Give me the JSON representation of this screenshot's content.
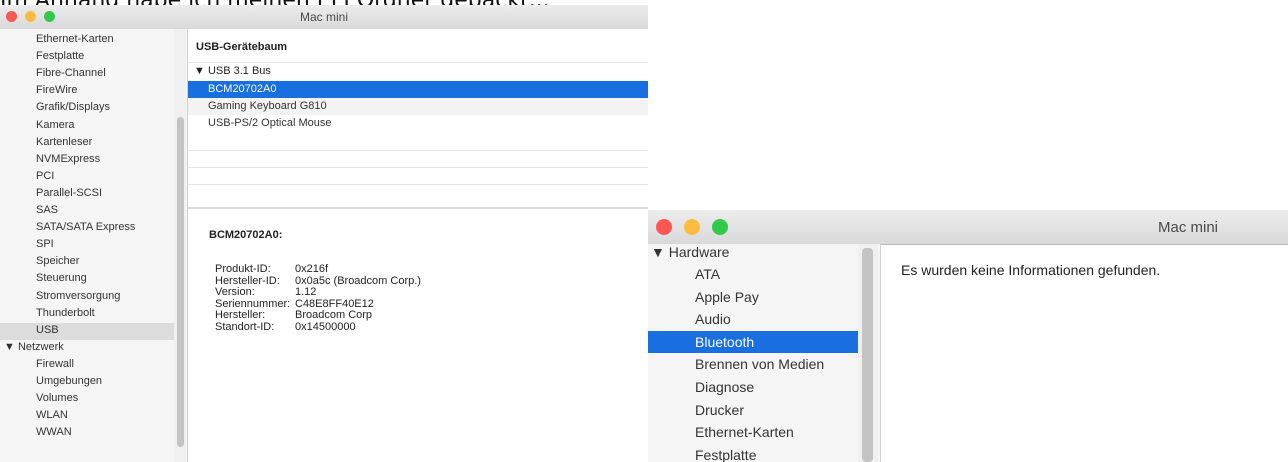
{
  "caption": "Im Anhang habe ich meinen EFI Ordner gepackt...",
  "window1": {
    "title": "Mac mini",
    "sidebar_items": [
      "Ethernet-Karten",
      "Festplatte",
      "Fibre-Channel",
      "FireWire",
      "Grafik/Displays",
      "Kamera",
      "Kartenleser",
      "NVMExpress",
      "PCI",
      "Parallel-SCSI",
      "SAS",
      "SATA/SATA Express",
      "SPI",
      "Speicher",
      "Steuerung",
      "Stromversorgung",
      "Thunderbolt",
      "USB"
    ],
    "group_netzwerk": "▼ Netzwerk",
    "netzwerk_items": [
      "Firewall",
      "Umgebungen",
      "Volumes",
      "WLAN",
      "WWAN"
    ],
    "tree_header": "USB-Gerätebaum",
    "tree_root": "▼ USB 3.1 Bus",
    "tree_items": [
      "BCM20702A0",
      "Gaming Keyboard G810",
      "USB-PS/2 Optical Mouse"
    ],
    "detail_title": "BCM20702A0:",
    "detail_labels": [
      "Produkt-ID:",
      "Hersteller-ID:",
      "Version:",
      "Seriennummer:",
      "Hersteller:",
      "Standort-ID:"
    ],
    "detail_values": [
      "0x216f",
      "0x0a5c  (Broadcom Corp.)",
      "1.12",
      "C48E8FF40E12",
      "Broadcom Corp",
      "0x14500000"
    ],
    "colors": {
      "selection": "#1a6fe0",
      "selection_gray": "#dcdcdc"
    }
  },
  "window2": {
    "title": "Mac mini",
    "group_hardware": "▼ Hardware",
    "sidebar_items": [
      "ATA",
      "Apple Pay",
      "Audio",
      "Bluetooth",
      "Brennen von Medien",
      "Diagnose",
      "Drucker",
      "Ethernet-Karten",
      "Festplatte"
    ],
    "selected_item": "Bluetooth",
    "message": "Es wurden keine Informationen gefunden."
  }
}
